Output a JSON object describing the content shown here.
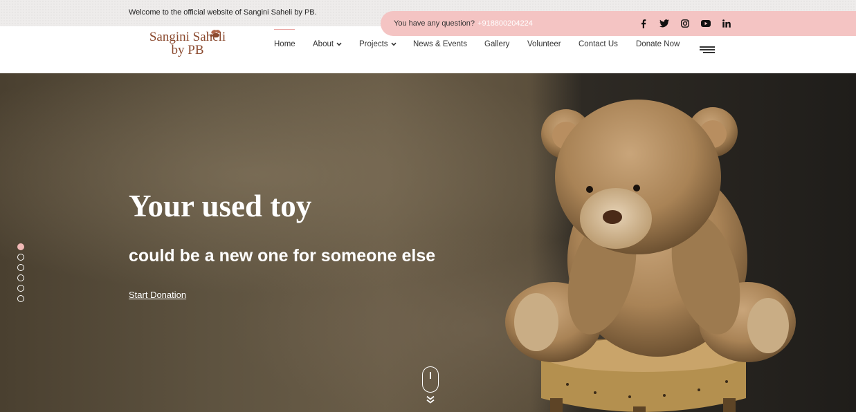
{
  "topbar": {
    "welcome": "Welcome to the official website of Sangini Saheli by PB.",
    "question": "You have any question?",
    "phone": "+918800204224",
    "socials": [
      "facebook-icon",
      "twitter-icon",
      "instagram-icon",
      "youtube-icon",
      "linkedin-icon"
    ]
  },
  "logo": {
    "line1": "Sangini Saheli",
    "line2": "by PB"
  },
  "nav": {
    "items": [
      {
        "label": "Home",
        "active": true
      },
      {
        "label": "About",
        "dropdown": true
      },
      {
        "label": "Projects",
        "dropdown": true
      },
      {
        "label": "News & Events"
      },
      {
        "label": "Gallery"
      },
      {
        "label": "Volunteer"
      },
      {
        "label": "Contact Us"
      },
      {
        "label": "Donate Now"
      }
    ]
  },
  "hero": {
    "title": "Your used toy",
    "subtitle": "could be a new one for someone else",
    "cta": "Start Donation",
    "slides": 6,
    "active_slide": 1
  },
  "colors": {
    "accent": "#f4c4c3",
    "logo": "#8b4a2f"
  }
}
